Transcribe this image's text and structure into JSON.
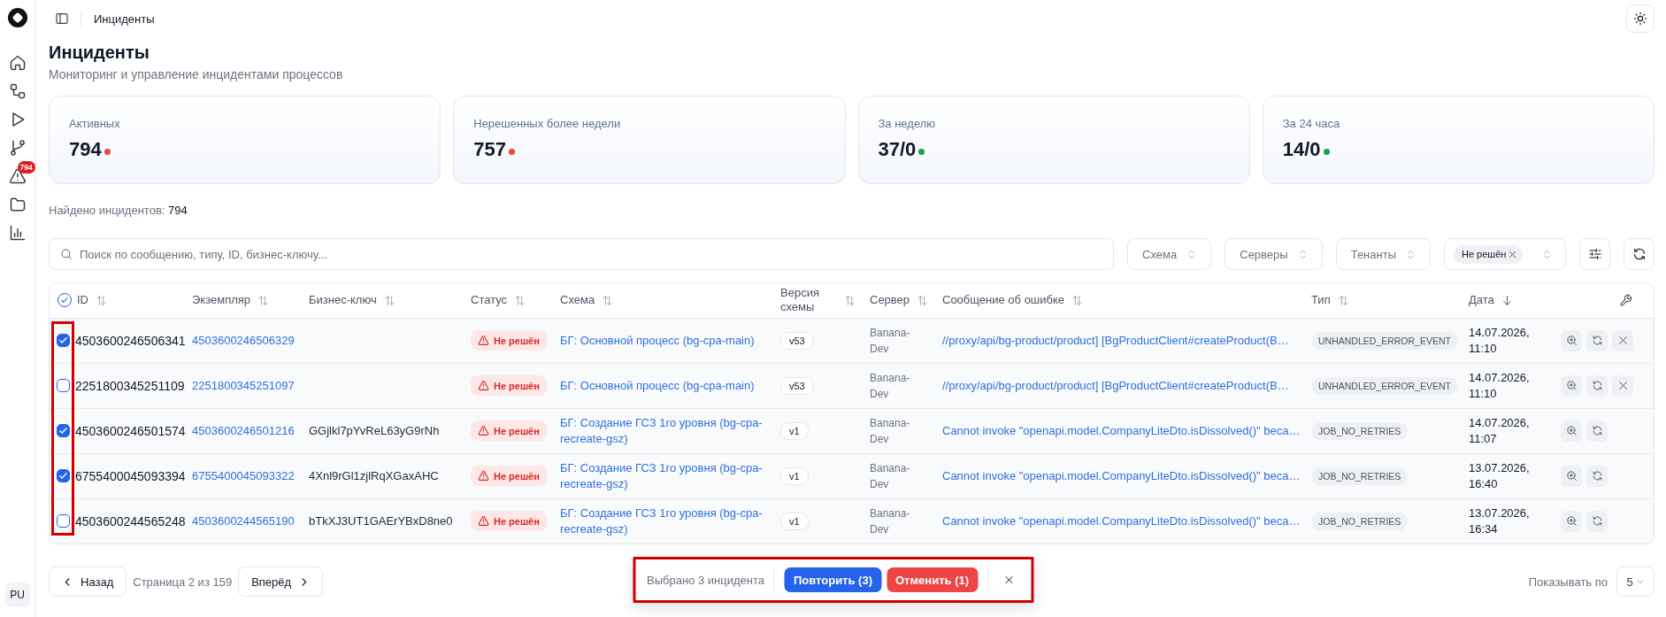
{
  "header": {
    "breadcrumb": "Инциденты"
  },
  "sidebar": {
    "alerts_badge": "794",
    "avatar": "PU"
  },
  "page": {
    "title": "Инциденты",
    "subtitle": "Мониторинг и управление инцидентами процессов"
  },
  "stats": [
    {
      "label": "Активных",
      "value": "794",
      "color": "#ef4444"
    },
    {
      "label": "Нерешенных более недели",
      "value": "757",
      "color": "#ef4444"
    },
    {
      "label": "За неделю",
      "value": "37/0",
      "color": "#16a34a"
    },
    {
      "label": "За 24 часа",
      "value": "14/0",
      "color": "#16a34a"
    }
  ],
  "found": {
    "label": "Найдено инцидентов:",
    "count": "794"
  },
  "filters": {
    "search": {
      "placeholder": "Поиск по сообщению, типу, ID, бизнес-ключу..."
    },
    "selects": [
      {
        "label": "Схема"
      },
      {
        "label": "Серверы"
      },
      {
        "label": "Тенанты"
      }
    ],
    "status_chips": [
      "Не решён"
    ]
  },
  "table": {
    "selection_highlighted": true,
    "select_all_checked": true,
    "columns": [
      {
        "label": "ID",
        "sorted": false
      },
      {
        "label": "Экземпляр",
        "sorted": false
      },
      {
        "label": "Бизнес-ключ",
        "sorted": false
      },
      {
        "label": "Статус",
        "sorted": false
      },
      {
        "label": "Схема",
        "sorted": false
      },
      {
        "label": "Версия схемы",
        "sorted": false
      },
      {
        "label": "Сервер",
        "sorted": false
      },
      {
        "label": "Сообщение об ошибке",
        "sorted": false
      },
      {
        "label": "Тип",
        "sorted": false
      },
      {
        "label": "Дата",
        "sorted": true
      }
    ],
    "rows": [
      {
        "selected": true,
        "id": "4503600246506341",
        "instance": "4503600246506329",
        "status": "Не решён",
        "schema": "БГ: Основной процесс (bg-cpa-main)",
        "version": "v53",
        "server": "Banana-Dev",
        "message": "//proxy/api/bg-product/product] [BgProductClient#createProduct(B…",
        "type": "UNHANDLED_ERROR_EVENT",
        "date": "14.07.2026, 11:10",
        "actions": [
          {
            "kind": "inspect"
          },
          {
            "kind": "retry"
          },
          {
            "kind": "cancel"
          }
        ]
      },
      {
        "selected": false,
        "id": "2251800345251109",
        "instance": "2251800345251097",
        "status": "Не решён",
        "schema": "БГ: Основной процесс (bg-cpa-main)",
        "version": "v53",
        "server": "Banana-Dev",
        "message": "//proxy/api/bg-product/product] [BgProductClient#createProduct(B…",
        "type": "UNHANDLED_ERROR_EVENT",
        "date": "14.07.2026, 11:10",
        "actions": [
          {
            "kind": "inspect"
          },
          {
            "kind": "retry"
          },
          {
            "kind": "cancel"
          }
        ]
      },
      {
        "selected": true,
        "id": "4503600246501574",
        "instance": "4503600246501216",
        "business_key": "GGjlkl7pYvReL63yG9rNh",
        "status": "Не решён",
        "schema": "БГ: Создание ГСЗ 1го уровня (bg-cpa-recreate-gsz)",
        "version": "v1",
        "server": "Banana-Dev",
        "message": "Cannot invoke \"openapi.model.CompanyLiteDto.isDissolved()\" beca…",
        "type": "JOB_NO_RETRIES",
        "date": "14.07.2026, 11:07",
        "actions": [
          {
            "kind": "inspect"
          },
          {
            "kind": "retry"
          }
        ]
      },
      {
        "selected": true,
        "id": "6755400045093394",
        "instance": "6755400045093322",
        "business_key": "4Xnl9rGl1zjlRqXGaxAHC",
        "status": "Не решён",
        "schema": "БГ: Создание ГСЗ 1го уровня (bg-cpa-recreate-gsz)",
        "version": "v1",
        "server": "Banana-Dev",
        "message": "Cannot invoke \"openapi.model.CompanyLiteDto.isDissolved()\" beca…",
        "type": "JOB_NO_RETRIES",
        "date": "13.07.2026, 16:40",
        "actions": [
          {
            "kind": "inspect"
          },
          {
            "kind": "retry"
          }
        ]
      },
      {
        "selected": false,
        "id": "4503600244565248",
        "instance": "4503600244565190",
        "business_key": "bTkXJ3UT1GAErYBxD8ne0",
        "status": "Не решён",
        "schema": "БГ: Создание ГСЗ 1го уровня (bg-cpa-recreate-gsz)",
        "version": "v1",
        "server": "Banana-Dev",
        "message": "Cannot invoke \"openapi.model.CompanyLiteDto.isDissolved()\" beca…",
        "type": "JOB_NO_RETRIES",
        "date": "13.07.2026, 16:34",
        "actions": [
          {
            "kind": "inspect"
          },
          {
            "kind": "retry"
          }
        ]
      }
    ]
  },
  "pagination": {
    "previous": "Назад",
    "info": "Страница 2 из 159",
    "next": "Вперёд"
  },
  "page_size": {
    "label": "Показывать по",
    "value": "5"
  },
  "selection_bar": {
    "highlighted": true,
    "text": "Выбрано 3 инцидента",
    "retry": "Повторить (3)",
    "cancel": "Отменить (1)"
  }
}
